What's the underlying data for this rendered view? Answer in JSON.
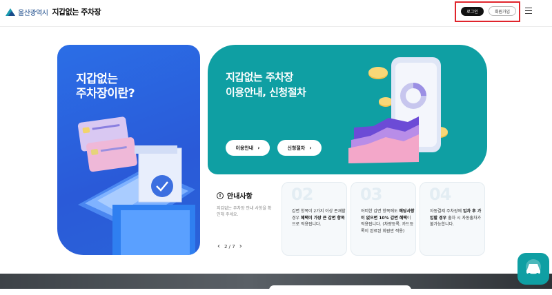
{
  "header": {
    "org": "울산광역시",
    "title": "지갑없는 주차장",
    "login_label": "로그인",
    "join_label": "회원가입",
    "menu_icon": "hamburger-icon"
  },
  "hero_left": {
    "title": "지갑없는\n주차장이란?"
  },
  "hero_right": {
    "title": "지갑없는 주차장\n이용안내, 신청절차",
    "buttons": [
      {
        "label": "이용안내",
        "chev": "›"
      },
      {
        "label": "신청절차",
        "chev": "›"
      }
    ]
  },
  "notice": {
    "title": "안내사항",
    "icon": "!",
    "description": "지갑없는 주차장 안내 사항을 확인해 주세요.",
    "pager": {
      "prev": "‹",
      "current": "2 / 7",
      "next": "›"
    }
  },
  "info_cards": [
    {
      "num": "02",
      "parts": [
        {
          "t": "감면 항목이 2가지 이상 존재할 경우 ",
          "b": false
        },
        {
          "t": "혜택이 가장 큰 감면 항목",
          "b": true
        },
        {
          "t": "으로 적용됩니다.",
          "b": false
        }
      ]
    },
    {
      "num": "03",
      "parts": [
        {
          "t": "어떠한 감면 항목에도 ",
          "b": false
        },
        {
          "t": "해당사항이 없으면 10% 감면 혜택",
          "b": true
        },
        {
          "t": "이 적용됩니다. (차량등록, 카드등록이 완료된 회원만 적용)",
          "b": false
        }
      ]
    },
    {
      "num": "04",
      "parts": [
        {
          "t": "자동결제 주차장에 ",
          "b": false
        },
        {
          "t": "입차 후 가입할 경우",
          "b": true
        },
        {
          "t": " 출차 시 자동출차가 불가능합니다.",
          "b": false
        }
      ]
    }
  ],
  "colors": {
    "blue": "#2a63d9",
    "teal": "#0f9fa3",
    "login_bg": "#111111",
    "highlight": "#e0242b"
  }
}
